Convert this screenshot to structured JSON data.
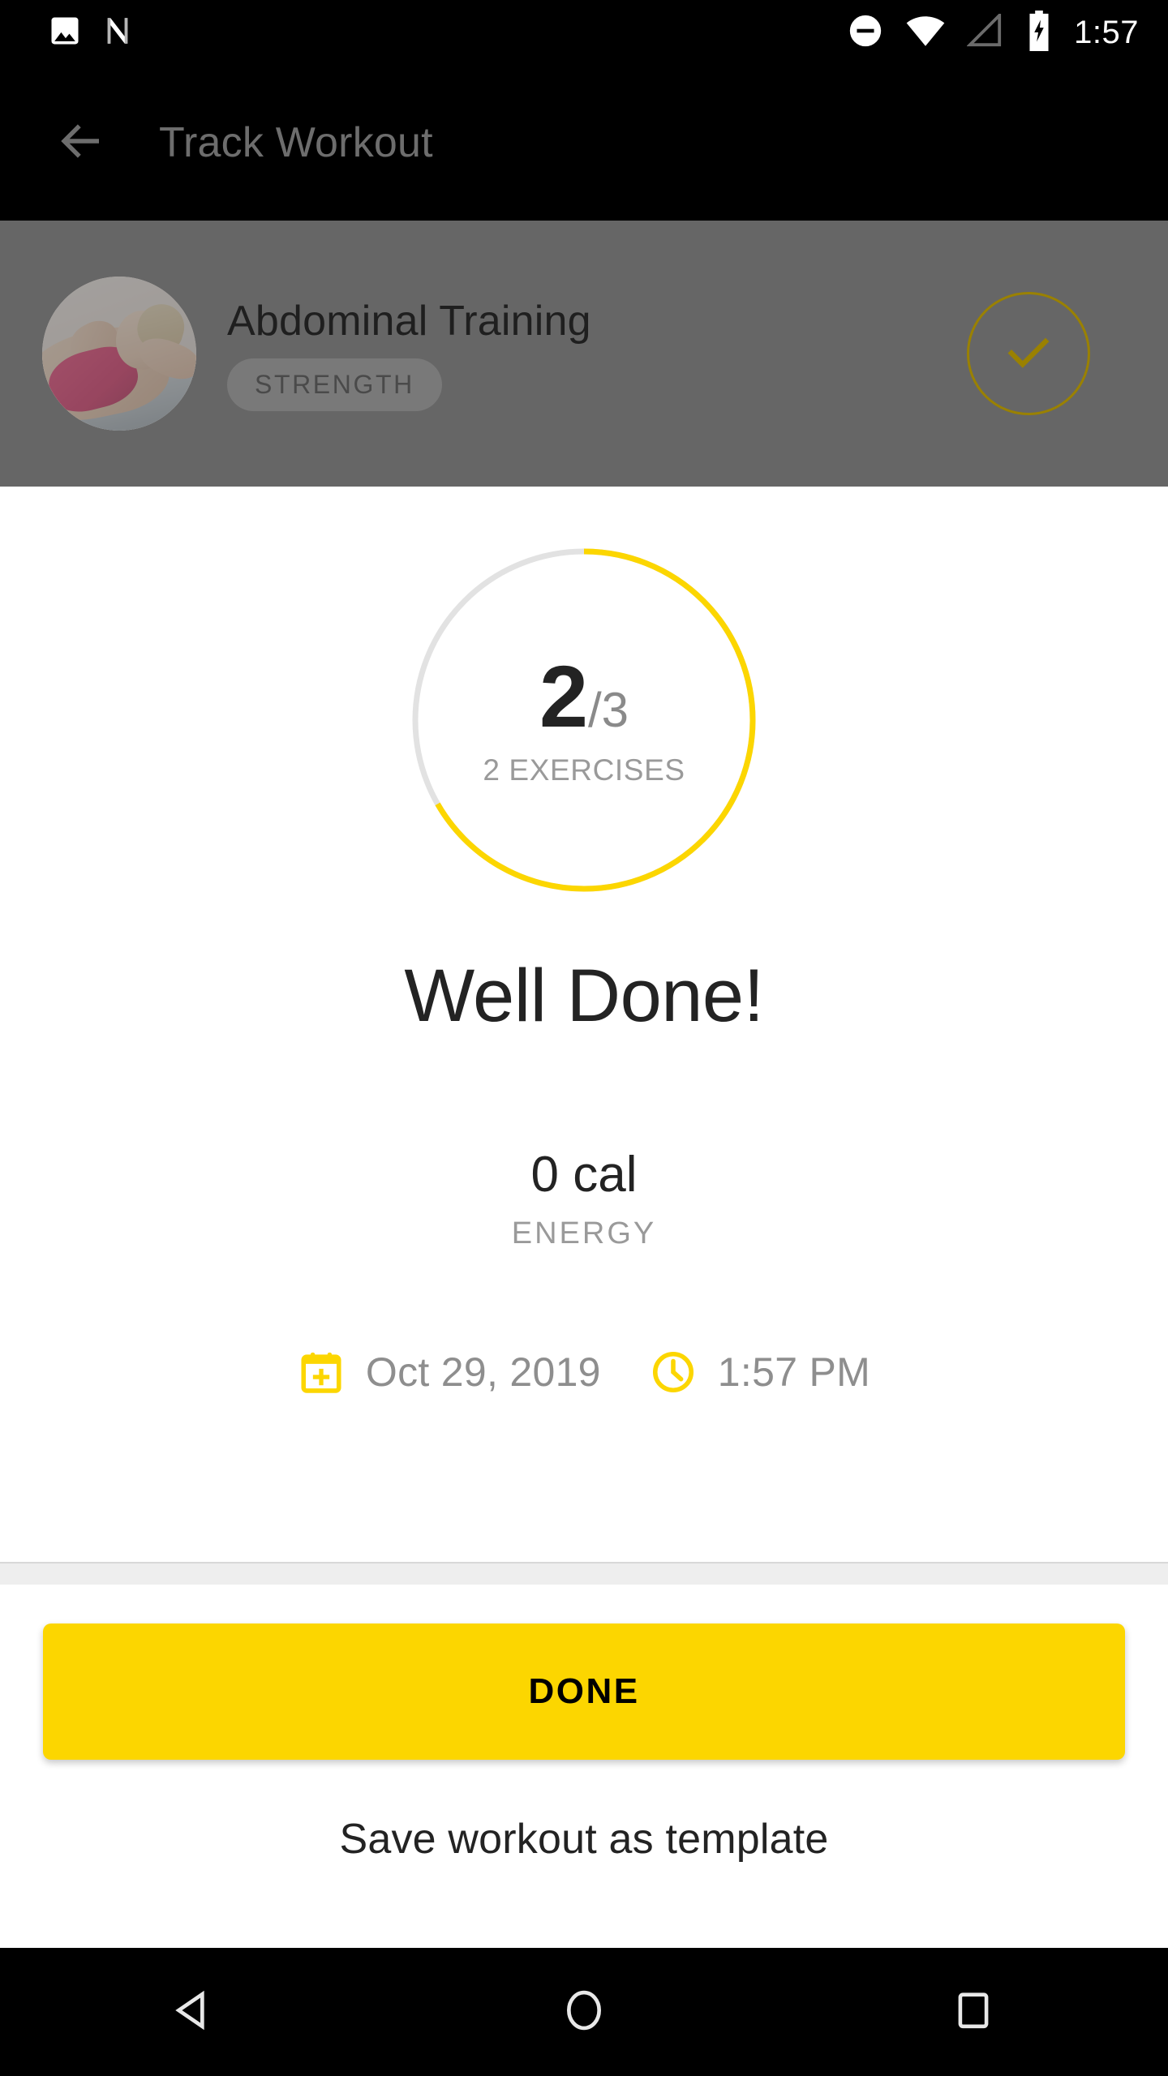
{
  "statusbar": {
    "time": "1:57",
    "icons": [
      "image-icon",
      "nfc-n-icon",
      "do-not-disturb-icon",
      "wifi-icon",
      "cell-signal-icon",
      "battery-charging-icon"
    ]
  },
  "appbar": {
    "back_icon": "back-arrow-icon",
    "title": "Track Workout"
  },
  "workout_header": {
    "avatar_icon": "workout-photo-avatar",
    "title": "Abdominal Training",
    "badge": "STRENGTH",
    "check_icon": "check-circle-icon"
  },
  "summary": {
    "progress": {
      "current": "2",
      "total": "/3",
      "label": "2 EXERCISES",
      "percent": 66.7,
      "track_color": "#e2e2e2",
      "arc_color": "#FCD600"
    },
    "headline": "Well Done!",
    "energy_value": "0 cal",
    "energy_label": "ENERGY",
    "date": {
      "icon": "calendar-plus-icon",
      "text": "Oct 29, 2019"
    },
    "time": {
      "icon": "clock-icon",
      "text": "1:57 PM"
    }
  },
  "actions": {
    "done_label": "DONE",
    "save_template_label": "Save workout as template"
  },
  "navbar": {
    "back_icon": "nav-back-triangle-icon",
    "home_icon": "nav-home-circle-icon",
    "recents_icon": "nav-recents-square-icon"
  },
  "colors": {
    "accent": "#FCD600",
    "scrim": "#666666",
    "text_primary": "#232323",
    "text_secondary": "#8e8e8e"
  }
}
